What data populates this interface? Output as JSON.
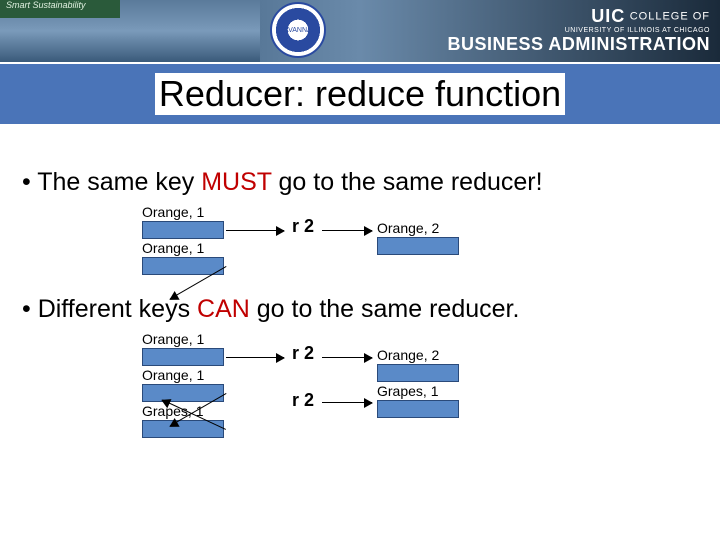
{
  "banner": {
    "sustainability": "Smart Sustainability",
    "badge": "SAVANNAH",
    "uic_prefix": "UIC",
    "college": "COLLEGE OF",
    "biz": "BUSINESS ADMINISTRATION",
    "sub": "UNIVERSITY OF ILLINOIS AT CHICAGO"
  },
  "title": "Reducer: reduce function",
  "bullets": {
    "b1_pre": "• The same key ",
    "b1_must": "MUST",
    "b1_post": " go to the same reducer!",
    "b2_pre": "• Different keys ",
    "b2_can": "CAN",
    "b2_post": " go to the same reducer."
  },
  "diagram1": {
    "in1": "Orange, 1",
    "in2": "Orange, 1",
    "r": "r 2",
    "out": "Orange, 2"
  },
  "diagram2": {
    "in1": "Orange, 1",
    "in2": "Orange, 1",
    "in3": "Grapes, 1",
    "r1": "r 2",
    "r2": "r 2",
    "out1": "Orange, 2",
    "out2": "Grapes, 1"
  }
}
